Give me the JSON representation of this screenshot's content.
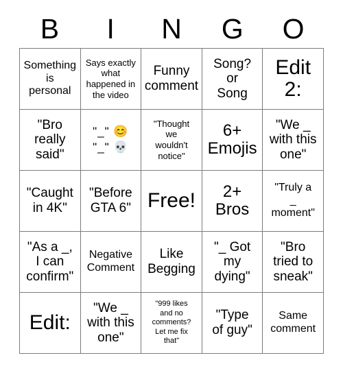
{
  "card": {
    "title_letters": [
      "B",
      "I",
      "N",
      "G",
      "O"
    ],
    "rows": [
      [
        {
          "text": "Something\nis\npersonal",
          "size": "fs-sm"
        },
        {
          "text": "Says exactly\nwhat\nhappened in\nthe video",
          "size": "fs-xs"
        },
        {
          "text": "Funny\ncomment",
          "size": "fs-md"
        },
        {
          "text": "Song?\nor\nSong",
          "size": "fs-md"
        },
        {
          "text": "Edit\n2:",
          "size": "fs-xl"
        }
      ],
      [
        {
          "text": "\"Bro\nreally\nsaid\"",
          "size": "fs-md"
        },
        {
          "text": "\"_\" 😊\n\"_\" 💀",
          "size": "emoji-cell"
        },
        {
          "text": "\"Thought\nwe\nwouldn't\nnotice\"",
          "size": "fs-xs"
        },
        {
          "text": "6+\nEmojis",
          "size": "fs-lg"
        },
        {
          "text": "\"We _\nwith this\none\"",
          "size": "fs-md"
        }
      ],
      [
        {
          "text": "\"Caught\nin 4K\"",
          "size": "fs-md"
        },
        {
          "text": "\"Before\nGTA 6\"",
          "size": "fs-md"
        },
        {
          "text": "Free!",
          "size": "fs-xl"
        },
        {
          "text": "2+\nBros",
          "size": "fs-lg"
        },
        {
          "text": "\"Truly a\n_\nmoment\"",
          "size": "fs-sm"
        }
      ],
      [
        {
          "text": "\"As a _,\nI can\nconfirm\"",
          "size": "fs-md"
        },
        {
          "text": "Negative\nComment",
          "size": "fs-sm"
        },
        {
          "text": "Like\nBegging",
          "size": "fs-md"
        },
        {
          "text": "\"_ Got\nmy\ndying\"",
          "size": "fs-md"
        },
        {
          "text": "\"Bro\ntried to\nsneak\"",
          "size": "fs-md"
        }
      ],
      [
        {
          "text": "Edit:",
          "size": "fs-xl"
        },
        {
          "text": "\"We _\nwith this\none\"",
          "size": "fs-md"
        },
        {
          "text": "\"999 likes\nand no\ncomments?\nLet me fix\nthat\"",
          "size": "fs-xxs"
        },
        {
          "text": "\"Type\nof guy\"",
          "size": "fs-md"
        },
        {
          "text": "Same\ncomment",
          "size": "fs-sm"
        }
      ]
    ]
  },
  "colors": {
    "grid_line": "#7b7b7b",
    "text": "#000000",
    "background": "#ffffff"
  }
}
